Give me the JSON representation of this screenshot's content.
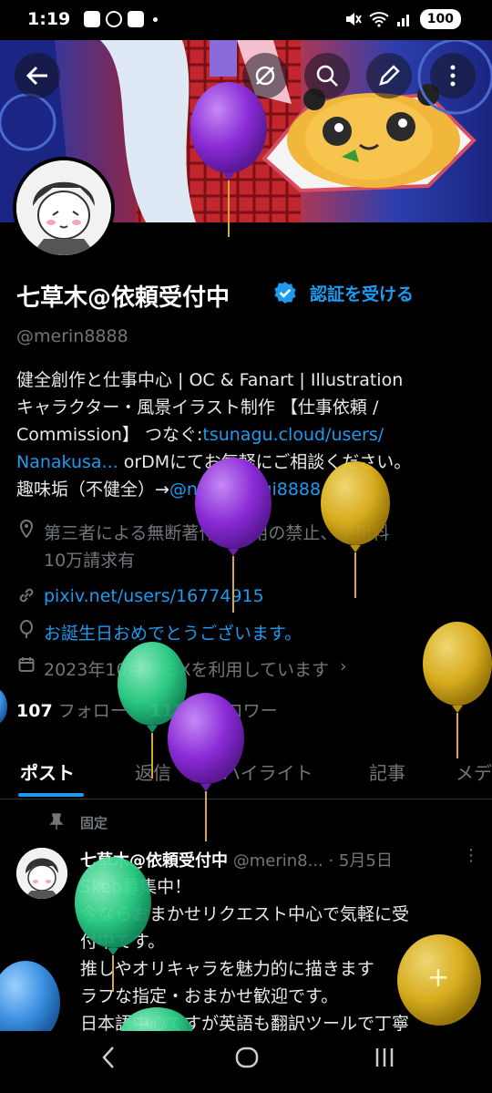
{
  "status_bar": {
    "time": "1:19",
    "battery": "100",
    "dot": "•"
  },
  "toolbar": {
    "back_icon": "back-arrow-icon",
    "grok_icon": "slash-circle-icon",
    "search_icon": "search-icon",
    "edit_icon": "pencil-icon",
    "more_icon": "more-vertical-icon"
  },
  "profile": {
    "name": "七草木@依頼受付中",
    "get_verified": "認証を受ける",
    "handle": "@merin8888",
    "bio_line1": "健全創作と仕事中心 | OC & Fanart | Illustration",
    "bio_line2": "キャラクター・風景イラスト制作 【仕事依頼 /",
    "bio_line3_a": "Commission】 つなぐ:",
    "bio_line3_link": "tsunagu.cloud/users/",
    "bio_line4_link": "Nanakusa...",
    "bio_line4_b": " orDMにてお気軽にご相談ください。",
    "bio_line5_a": "趣味垢（不健全）→",
    "bio_line5_link": "@nanakuagi8888",
    "location": "第三者による無断著作物利用の禁止、使用料",
    "location2": "10万請求有",
    "website": "pixiv.net/users/16774915",
    "birthday": "お誕生日おめでとうございます。",
    "joined": "2023年10月からXを利用しています",
    "following_count": "107",
    "following_label": "フォロー",
    "followers_count": "117",
    "followers_label": "フォロワー"
  },
  "tabs": [
    {
      "label": "ポスト"
    },
    {
      "label": "返信"
    },
    {
      "label": "ハイライト"
    },
    {
      "label": "記事"
    },
    {
      "label": "メデ"
    }
  ],
  "post": {
    "pinned_label": "固定",
    "author": "七草木@依頼受付中",
    "meta": "@merin8... · 5月5日",
    "line1": "Skeb募集中！",
    "line2": "今ならおまかせリクエスト中心で気軽に受",
    "line3": "付中です。",
    "line4": "推しやオリキャラを魅力的に描きます",
    "line5": "ラフな指定・おまかせ歓迎です。",
    "line6": "日本語中心ですが英語も翻訳ツールで丁寧"
  },
  "fab": {
    "label": "+"
  },
  "colors": {
    "accent": "#1d9bf0",
    "balloon_purple": "#8a2bd6",
    "balloon_yellow": "#e3b51f",
    "balloon_green": "#2ed38a",
    "balloon_blue": "#3a8fe0"
  }
}
